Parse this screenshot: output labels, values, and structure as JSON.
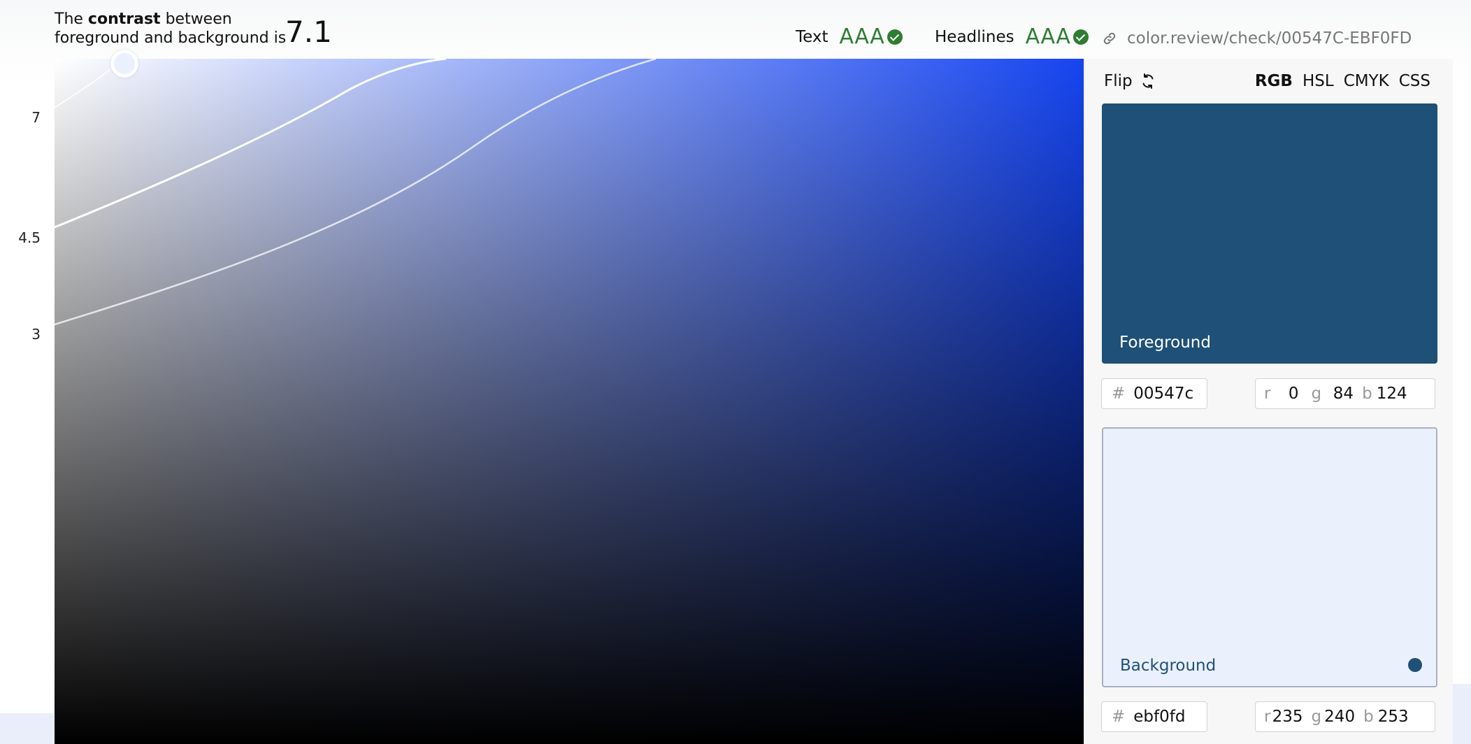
{
  "header": {
    "contrast_prefix": "The",
    "contrast_bold": "contrast",
    "contrast_suffix": "between",
    "contrast_line2": "foreground and background is",
    "contrast_value": "7.1",
    "text_rating": {
      "label": "Text",
      "level": "AAA",
      "icon": "check-circle-icon"
    },
    "headlines_rating": {
      "label": "Headlines",
      "level": "AAA",
      "icon": "check-circle-icon"
    },
    "link": {
      "icon": "link-icon",
      "text": "color.review/check/00547C-EBF0FD"
    }
  },
  "axis": {
    "ticks": [
      "7",
      "4.5",
      "3"
    ]
  },
  "canvas": {
    "hue_color": "#1645f0",
    "marker_color": "#ebf0fd"
  },
  "panel": {
    "flip_label": "Flip",
    "flip_icon": "refresh-icon",
    "modes": [
      "RGB",
      "HSL",
      "CMYK",
      "CSS"
    ],
    "active_mode": "RGB",
    "foreground": {
      "label": "Foreground",
      "color": "#1f5077",
      "hex": "00547c",
      "r": "0",
      "g": "84",
      "b": "124"
    },
    "background": {
      "label": "Background",
      "color": "#ebf0fd",
      "hex": "ebf0fd",
      "r": "235",
      "g": "240",
      "b": "253",
      "dot_color": "#1f5077"
    },
    "hash_symbol": "#",
    "channel_labels": {
      "r": "r",
      "g": "g",
      "b": "b"
    }
  }
}
